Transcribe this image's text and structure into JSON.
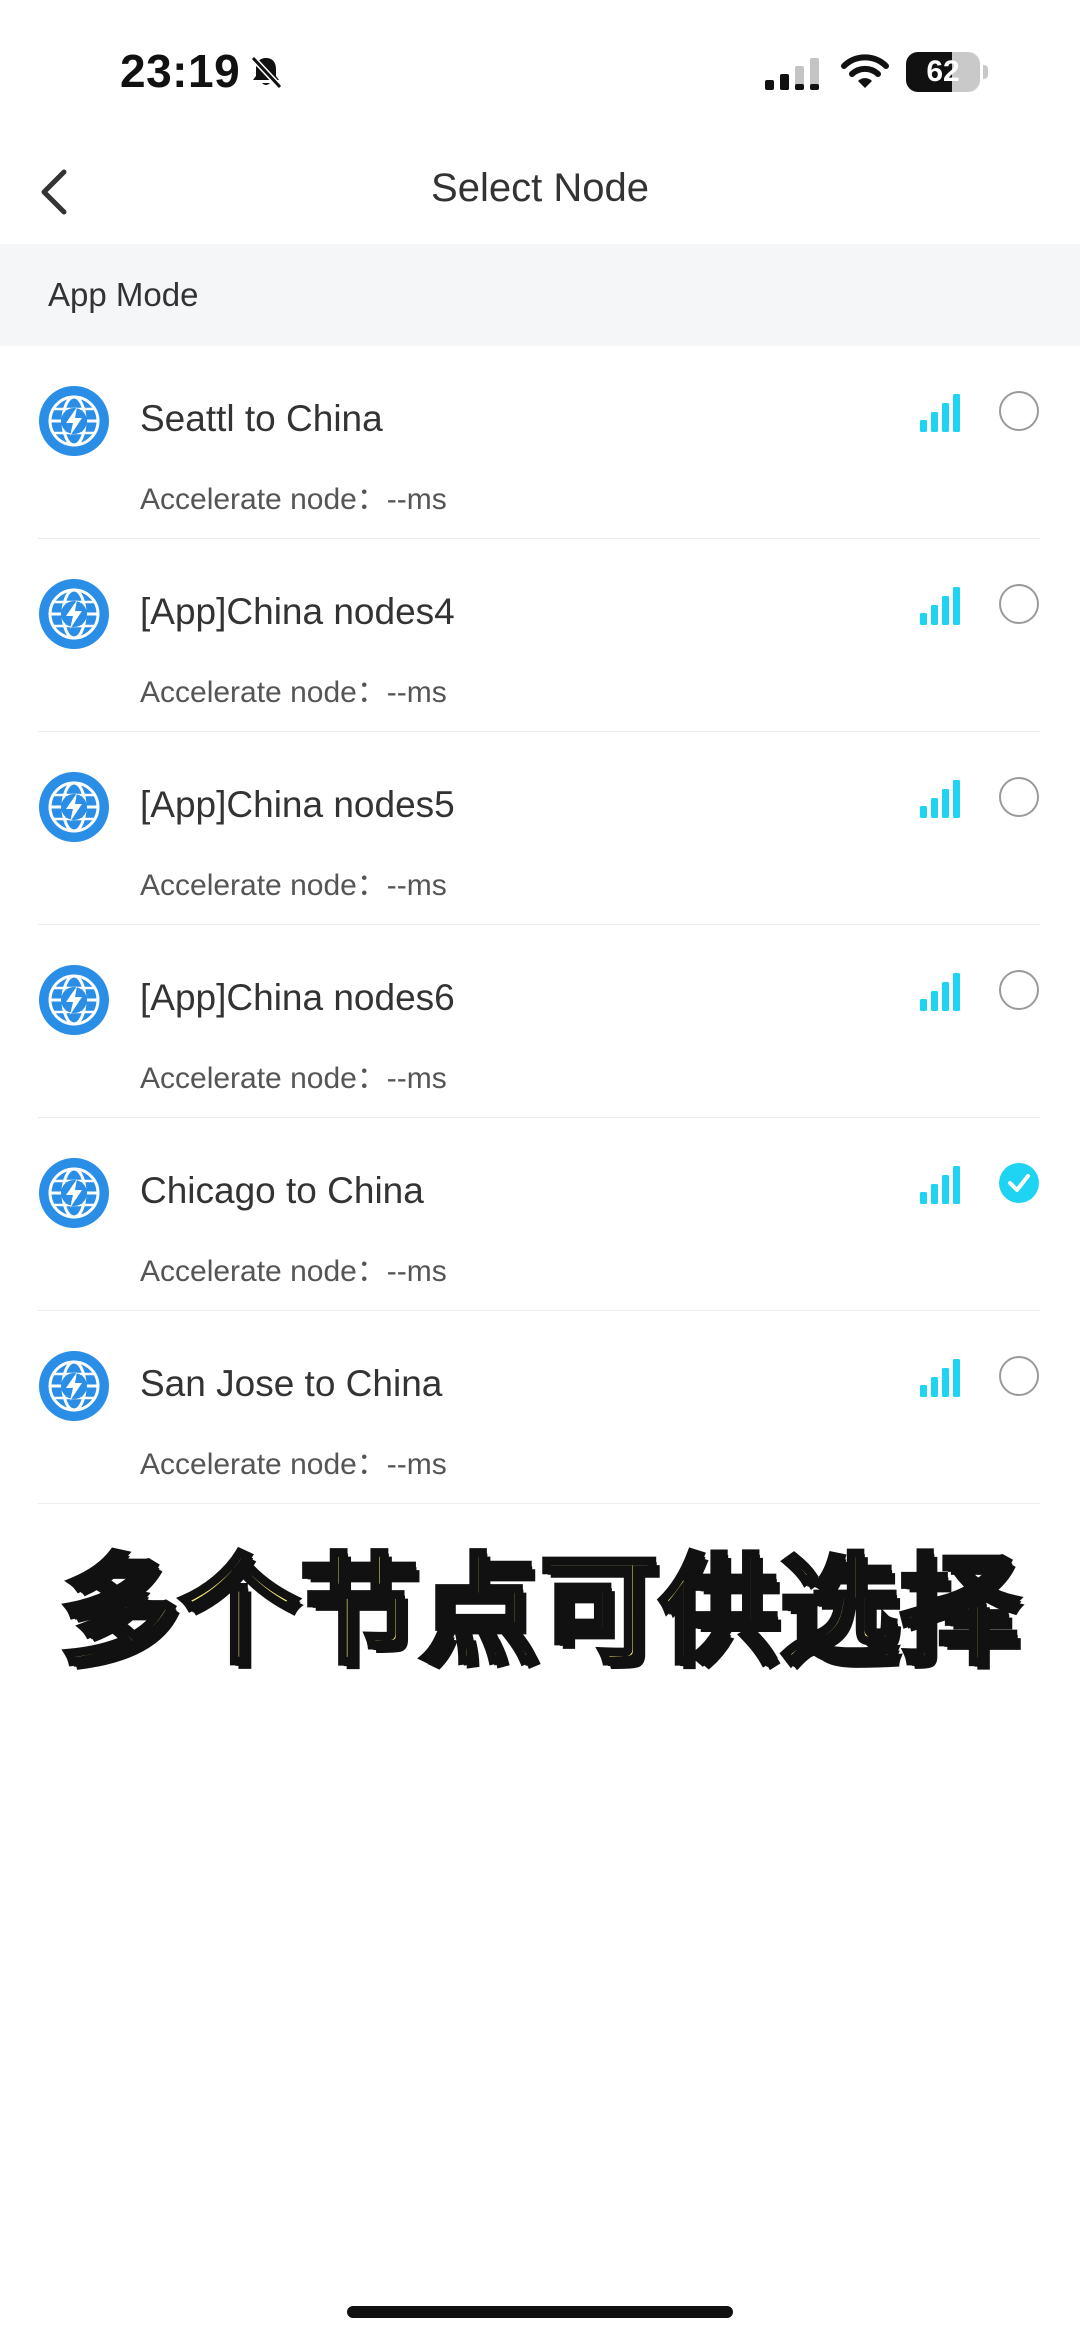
{
  "status_bar": {
    "time": "23:19",
    "battery": "62",
    "battery_level": 0.62
  },
  "nav": {
    "title": "Select Node"
  },
  "section": {
    "title": "App Mode"
  },
  "nodes": [
    {
      "name": "Seattl to China",
      "latency": "Accelerate node：--ms",
      "selected": false
    },
    {
      "name": "[App]China nodes4",
      "latency": "Accelerate node：--ms",
      "selected": false
    },
    {
      "name": "[App]China nodes5",
      "latency": "Accelerate node：--ms",
      "selected": false
    },
    {
      "name": "[App]China nodes6",
      "latency": "Accelerate node：--ms",
      "selected": false
    },
    {
      "name": "Chicago to China",
      "latency": "Accelerate node：--ms",
      "selected": true
    },
    {
      "name": "San Jose to China",
      "latency": "Accelerate node：--ms",
      "selected": false
    }
  ],
  "overlay": {
    "caption": "多个节点可供选择"
  },
  "colors": {
    "accent": "#1fd3f3",
    "globe": "#2b8ee6",
    "caption_fill": "#f7e97a"
  },
  "icons": {
    "back": "chevron-left-icon",
    "node": "globe-bolt-icon",
    "signal": "signal-bars-icon",
    "selected": "check-icon",
    "mute": "bell-slash-icon",
    "cellular": "cellular-icon",
    "wifi": "wifi-icon"
  }
}
